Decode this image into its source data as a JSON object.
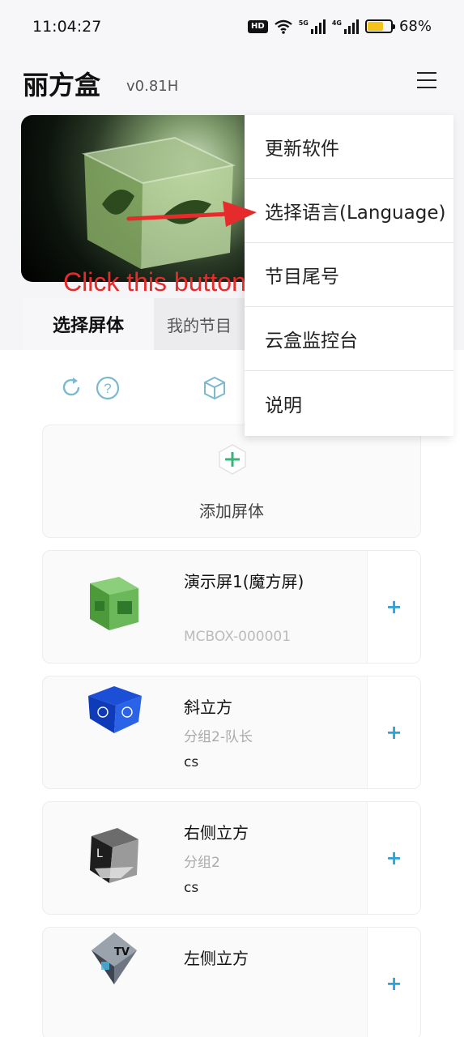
{
  "status_bar": {
    "time": "11:04:27",
    "hd_label": "HD",
    "net_5g": "5G",
    "net_4g": "4G",
    "battery": "68%",
    "battery_level": 0.68,
    "battery_color": "#f3c21b"
  },
  "app": {
    "title": "丽方盒",
    "version": "v0.81H",
    "menu_icon": "hamburger-icon"
  },
  "tabs": [
    {
      "label": "选择屏体",
      "active": true
    },
    {
      "label": "我的节目",
      "active": false
    }
  ],
  "toolbar": {
    "icons": [
      "refresh-icon",
      "help-icon",
      "cube-icon"
    ]
  },
  "add_screen": {
    "label": "添加屏体",
    "icon": "hex-plus-icon"
  },
  "screens": [
    {
      "name": "演示屏1(魔方屏)",
      "group": "",
      "code": "MCBOX-000001",
      "thumb": "green-cube-icon",
      "add": "+"
    },
    {
      "name": "斜立方",
      "group": "分组2-队长",
      "code": "cs",
      "thumb": "blue-cube-icon",
      "add": "+"
    },
    {
      "name": "右侧立方",
      "group": "分组2",
      "code": "cs",
      "thumb": "silver-cube-icon",
      "add": "+"
    },
    {
      "name": "左侧立方",
      "group": "",
      "code": "",
      "thumb": "tv-cube-icon",
      "add": "+"
    }
  ],
  "dropdown_menu": {
    "items": [
      "更新软件",
      "选择语言(Language)",
      "节目尾号",
      "云盒监控台",
      "说明"
    ]
  },
  "annotation": {
    "text": "Click this button",
    "color": "#e52b2b"
  },
  "colors": {
    "accent": "#2ba3d9",
    "add_icon": "#3bb37a",
    "annotation": "#e52b2b"
  }
}
